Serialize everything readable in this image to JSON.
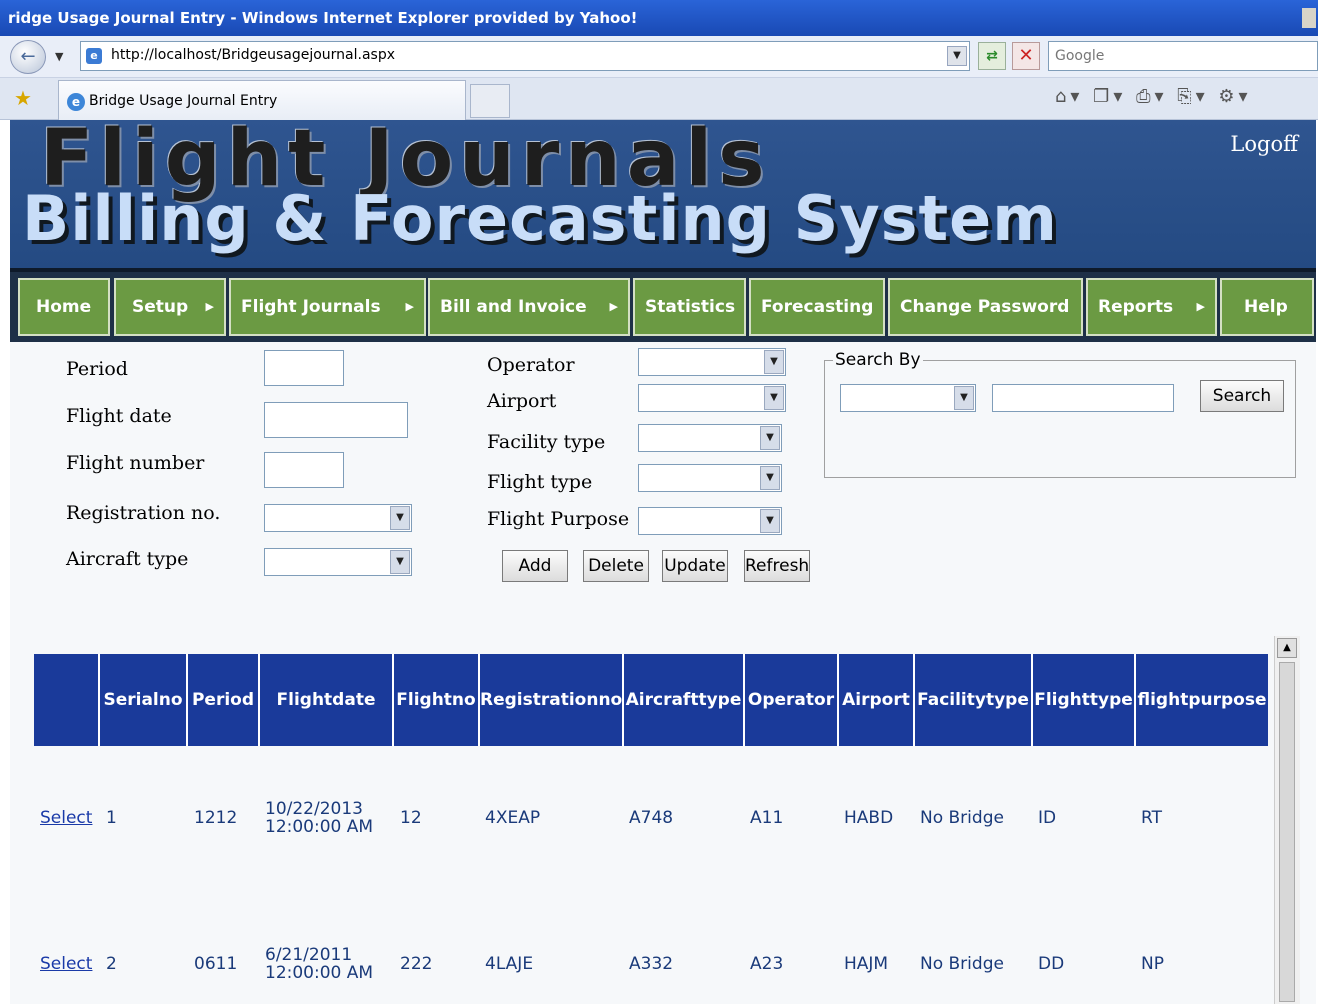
{
  "browser": {
    "window_title": "ridge Usage Journal Entry - Windows Internet Explorer provided by Yahoo!",
    "url": "http://localhost/Bridgeusagejournal.aspx",
    "search_placeholder": "Google",
    "tab_title": "Bridge Usage Journal Entry"
  },
  "header": {
    "logo_line1": "Flight Journals",
    "logo_line2": "Billing & Forecasting System",
    "logoff": "Logoff"
  },
  "menu": {
    "items": [
      {
        "label": "Home",
        "has_submenu": false
      },
      {
        "label": "Setup",
        "has_submenu": true
      },
      {
        "label": "Flight Journals",
        "has_submenu": true
      },
      {
        "label": "Bill and Invoice",
        "has_submenu": true
      },
      {
        "label": "Statistics",
        "has_submenu": false
      },
      {
        "label": "Forecasting",
        "has_submenu": false
      },
      {
        "label": "Change Password",
        "has_submenu": false
      },
      {
        "label": "Reports",
        "has_submenu": true
      },
      {
        "label": "Help",
        "has_submenu": false
      }
    ]
  },
  "form": {
    "period_label": "Period",
    "flight_date_label": "Flight date",
    "flight_number_label": "Flight number",
    "registration_label": "Registration no.",
    "aircraft_type_label": "Aircraft type",
    "operator_label": "Operator",
    "airport_label": "Airport",
    "facility_type_label": "Facility type",
    "flight_type_label": "Flight type",
    "flight_purpose_label": "Flight Purpose",
    "add_label": "Add",
    "delete_label": "Delete",
    "update_label": "Update",
    "refresh_label": "Refresh"
  },
  "search_by": {
    "legend": "Search By",
    "button_label": "Search"
  },
  "grid": {
    "headers": [
      "",
      "Serialno",
      "Period",
      "Flightdate",
      "Flightno",
      "Registrationno",
      "Aircrafttype",
      "Operator",
      "Airport",
      "Facilitytype",
      "Flighttype",
      "flightpurpose"
    ],
    "rows": [
      {
        "select": "Select",
        "serialno": "1",
        "period": "1212",
        "flightdate_date": "10/22/2013",
        "flightdate_time": "12:00:00 AM",
        "flightno": "12",
        "registrationno": "4XEAP",
        "aircrafttype": "A748",
        "operator": "A11",
        "airport": "HABD",
        "facilitytype": "No Bridge",
        "flighttype": "ID",
        "flightpurpose": "RT"
      },
      {
        "select": "Select",
        "serialno": "2",
        "period": "0611",
        "flightdate_date": "6/21/2011",
        "flightdate_time": "12:00:00 AM",
        "flightno": "222",
        "registrationno": "4LAJE",
        "aircrafttype": "A332",
        "operator": "A23",
        "airport": "HAJM",
        "facilitytype": "No Bridge",
        "flighttype": "DD",
        "flightpurpose": "NP"
      }
    ]
  },
  "colors": {
    "menu_green": "#6b9a43",
    "grid_header_blue": "#1a3a9a",
    "banner_blue": "#2f5590"
  }
}
